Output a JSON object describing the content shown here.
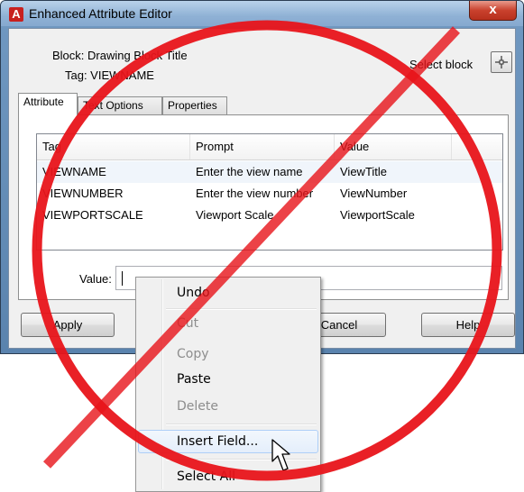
{
  "window": {
    "title": "Enhanced Attribute Editor",
    "app_icon_letter": "A",
    "close_glyph": "x"
  },
  "header": {
    "block": "Block: Drawing Block Title",
    "tag": "Tag: VIEWNAME",
    "select_block_label": "Select block",
    "select_block_icon": "crosshair-icon"
  },
  "tabs": [
    {
      "label": "Attribute",
      "active": true
    },
    {
      "label": "Text Options",
      "active": false
    },
    {
      "label": "Properties",
      "active": false
    }
  ],
  "table": {
    "columns": [
      "Tag",
      "Prompt",
      "Value"
    ],
    "rows": [
      {
        "tag": "VIEWNAME",
        "prompt": "Enter the view name",
        "value": "ViewTitle"
      },
      {
        "tag": "VIEWNUMBER",
        "prompt": "Enter the view number",
        "value": "ViewNumber"
      },
      {
        "tag": "VIEWPORTSCALE",
        "prompt": "Viewport Scale",
        "value": "ViewportScale"
      }
    ]
  },
  "value_field": {
    "label": "Value:",
    "value": ""
  },
  "buttons": {
    "apply": "Apply",
    "cancel": "Cancel",
    "help": "Help"
  },
  "context_menu": {
    "items": [
      {
        "label": "Undo",
        "disabled": false
      },
      {
        "label": "Cut",
        "disabled": true
      },
      {
        "label": "Copy",
        "disabled": true
      },
      {
        "label": "Paste",
        "disabled": false
      },
      {
        "label": "Delete",
        "disabled": true
      },
      {
        "label": "Insert Field...",
        "disabled": false,
        "highlighted": true
      },
      {
        "label": "Select All",
        "disabled": false
      }
    ]
  },
  "colors": {
    "annotation_red": "#e8141a",
    "titlebar": "#8fb1d5",
    "close_button": "#c9412d"
  }
}
